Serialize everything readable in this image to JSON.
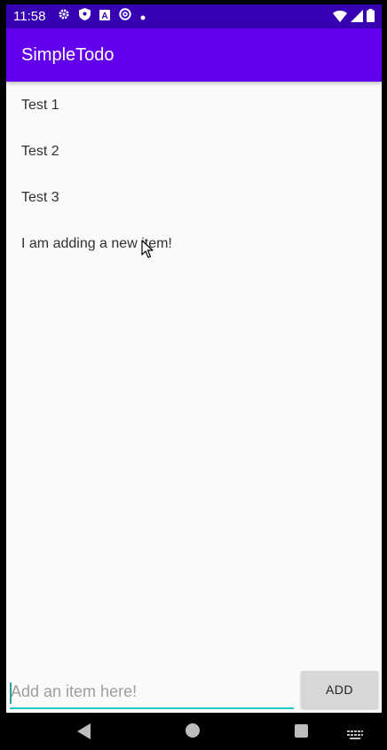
{
  "status_bar": {
    "time": "11:58",
    "left_icons": [
      "gear-icon",
      "shield-icon",
      "a-box-icon",
      "at-circle-icon",
      "dot-icon"
    ],
    "right_icons": [
      "wifi-icon",
      "signal-icon",
      "battery-icon"
    ]
  },
  "app_bar": {
    "title": "SimpleTodo"
  },
  "todo_list": {
    "items": [
      {
        "text": "Test 1"
      },
      {
        "text": "Test 2"
      },
      {
        "text": "Test 3"
      },
      {
        "text": "I am adding a new item!"
      }
    ]
  },
  "add_row": {
    "input_value": "",
    "input_placeholder": "Add an item here!",
    "button_label": "ADD"
  },
  "nav_bar": {
    "icons": [
      "back-icon",
      "home-icon",
      "recents-icon",
      "keyboard-icon"
    ]
  },
  "colors": {
    "status_bar": "#3700b3",
    "app_bar": "#6200ee",
    "accent": "#26c6c6",
    "button": "#d6d7d7",
    "background": "#fafafa"
  }
}
